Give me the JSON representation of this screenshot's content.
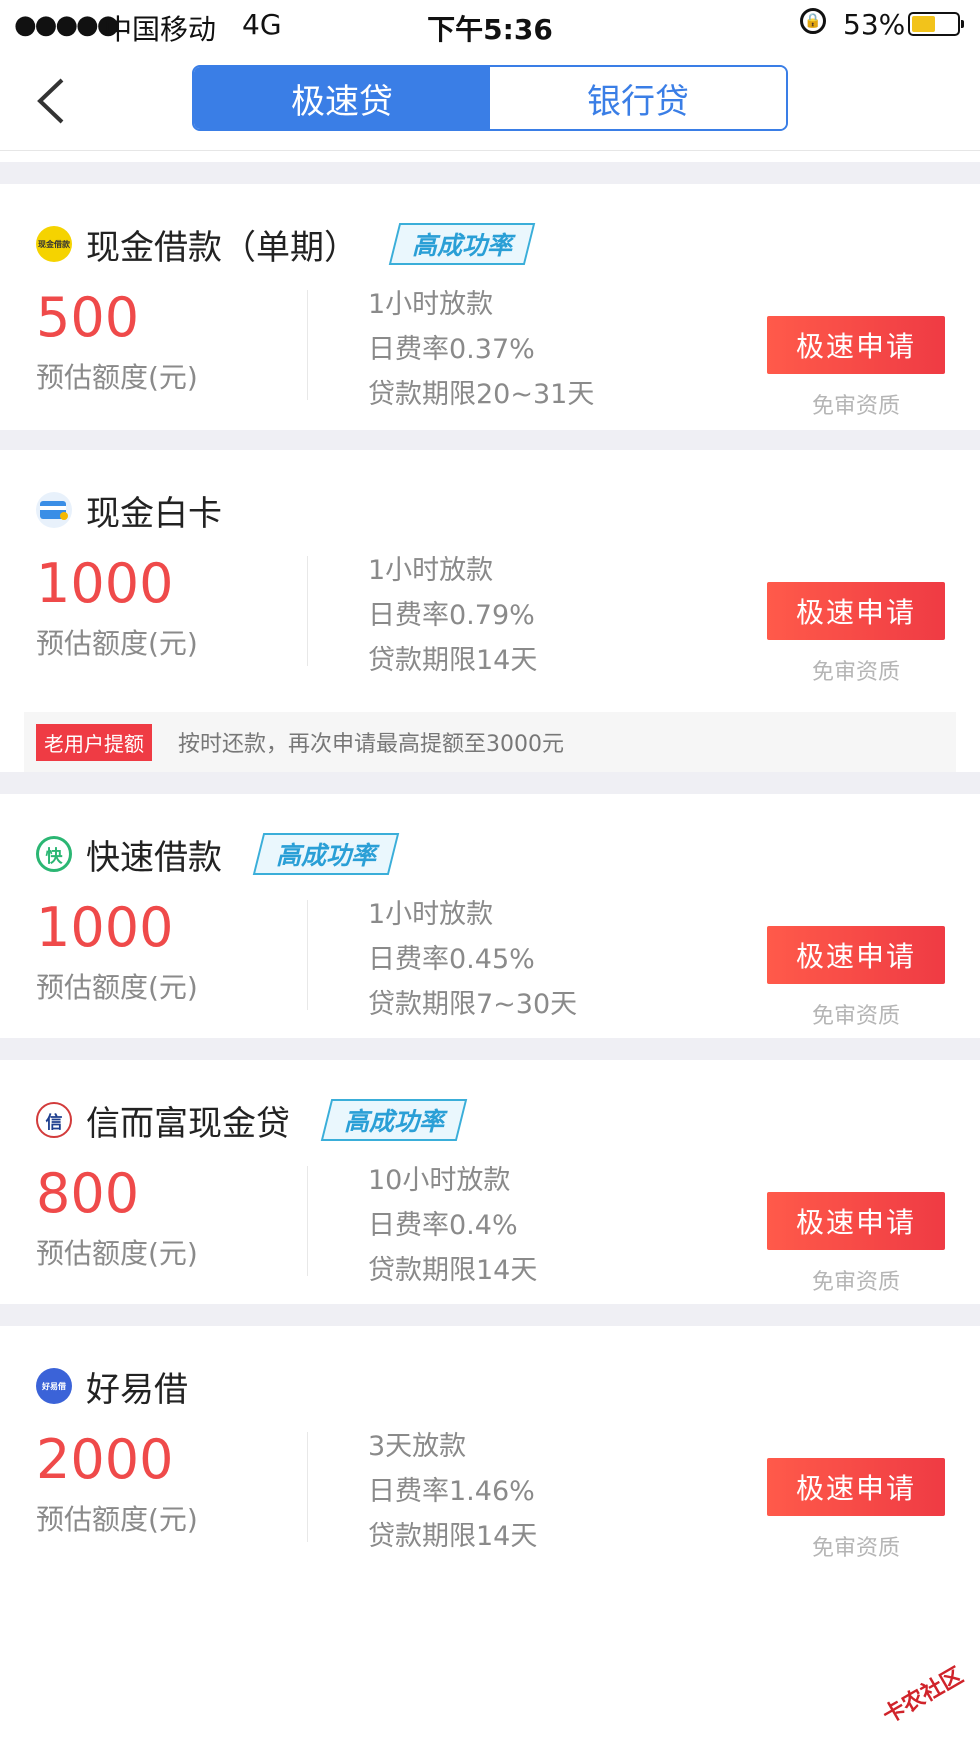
{
  "status_bar": {
    "signal": "●●●●●",
    "carrier": "中国移动",
    "network": "4G",
    "time": "下午5:36",
    "battery": "53%",
    "battery_level": 0.53,
    "battery_color": "#f2c31b"
  },
  "nav": {
    "tabs": [
      {
        "label": "极速贷",
        "active": true
      },
      {
        "label": "银行贷",
        "active": false
      }
    ],
    "accent": "#3a7ee6"
  },
  "loans": [
    {
      "name": "现金借款（单期）",
      "icon": "xianjin-jiekuan-logo",
      "tag": "高成功率",
      "amount": "500",
      "amount_label": "预估额度(元)",
      "disbursement": "1小时放款",
      "daily_rate": "日费率0.37%",
      "term": "贷款期限20~31天",
      "apply_label": "极速申请",
      "subtitle": "免审资质"
    },
    {
      "name": "现金白卡",
      "icon": "card-logo",
      "amount": "1000",
      "amount_label": "预估额度(元)",
      "disbursement": "1小时放款",
      "daily_rate": "日费率0.79%",
      "term": "贷款期限14天",
      "apply_label": "极速申请",
      "subtitle": "免审资质",
      "promo_badge": "老用户提额",
      "promo_text": "按时还款，再次申请最高提额至3000元"
    },
    {
      "name": "快速借款",
      "icon": "kuai-logo",
      "tag": "高成功率",
      "amount": "1000",
      "amount_label": "预估额度(元)",
      "disbursement": "1小时放款",
      "daily_rate": "日费率0.45%",
      "term": "贷款期限7~30天",
      "apply_label": "极速申请",
      "subtitle": "免审资质"
    },
    {
      "name": "信而富现金贷",
      "icon": "xin-logo",
      "tag": "高成功率",
      "amount": "800",
      "amount_label": "预估额度(元)",
      "disbursement": "10小时放款",
      "daily_rate": "日费率0.4%",
      "term": "贷款期限14天",
      "apply_label": "极速申请",
      "subtitle": "免审资质"
    },
    {
      "name": "好易借",
      "icon": "haoyijie-logo",
      "amount": "2000",
      "amount_label": "预估额度(元)",
      "disbursement": "3天放款",
      "daily_rate": "日费率1.46%",
      "term": "贷款期限14天",
      "apply_label": "极速申请",
      "subtitle": "免审资质"
    }
  ],
  "logo_text": {
    "xianjin": "现金借款",
    "kuai": "快",
    "xin": "信",
    "haoyijie": "好易借"
  },
  "watermark": "卡农社区",
  "colors": {
    "amount": "#ef4a4a",
    "apply_button": "#ef3b44",
    "tag": "#2a9fd6"
  }
}
